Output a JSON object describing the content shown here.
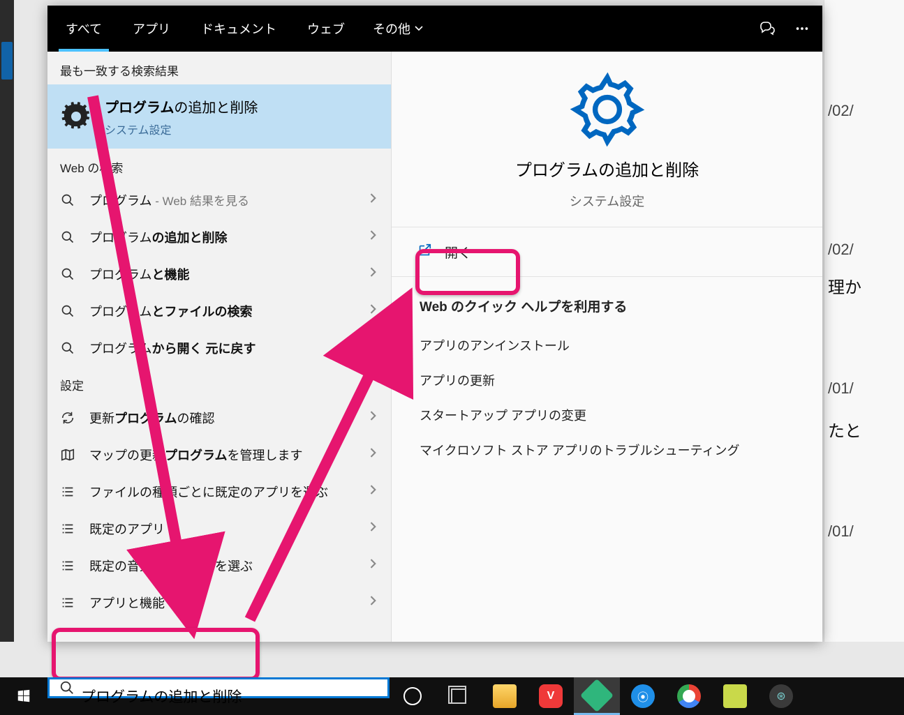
{
  "tabs": {
    "all": "すべて",
    "apps": "アプリ",
    "docs": "ドキュメント",
    "web": "ウェブ",
    "more": "その他"
  },
  "sections": {
    "best": "最も一致する検索結果",
    "web": "Web の検索",
    "settings": "設定"
  },
  "bestMatch": {
    "titlePre": "プログラム",
    "titleBold": "の追加と削除",
    "subtitle": "システム設定"
  },
  "webResults": [
    {
      "pre": "プログラム",
      "bold": "",
      "suf": " - Web 結果を見る"
    },
    {
      "pre": "プログラム",
      "bold": "の追加と削除",
      "suf": ""
    },
    {
      "pre": "プログラム",
      "bold": "と機能",
      "suf": ""
    },
    {
      "pre": "プログラム",
      "bold": "とファイルの検索",
      "suf": ""
    },
    {
      "pre": "プログラム",
      "bold": "から開く 元に戻す",
      "suf": ""
    }
  ],
  "settingsResults": [
    {
      "icon": "refresh",
      "pre": "更新",
      "bold": "プログラム",
      "post": "の確認"
    },
    {
      "icon": "map",
      "pre": "マップの更新",
      "bold": "プログラム",
      "post": "を管理します"
    },
    {
      "icon": "list",
      "pre": "ファイルの種類ごとに既定のアプリを選ぶ",
      "bold": "",
      "post": ""
    },
    {
      "icon": "list",
      "pre": "既定のアプリ",
      "bold": "",
      "post": ""
    },
    {
      "icon": "list",
      "pre": "既定の音楽プレーヤーを選ぶ",
      "bold": "",
      "post": ""
    },
    {
      "icon": "list",
      "pre": "アプリと機能",
      "bold": "",
      "post": ""
    }
  ],
  "preview": {
    "title": "プログラムの追加と削除",
    "subtitle": "システム設定",
    "open": "開く",
    "quickHelpHeader": "Web のクイック ヘルプを利用する",
    "quickLinks": [
      "アプリのアンインストール",
      "アプリの更新",
      "スタートアップ アプリの変更",
      "マイクロソフト ストア アプリのトラブルシューティング"
    ]
  },
  "searchBox": {
    "typed": "プログラム",
    "ghost": "の追加と削除"
  },
  "bgFragments": {
    "f1": "/02/",
    "f2": "/02/",
    "f3": "理か",
    "f4": "/01/",
    "f5": "たと",
    "f6": "/01/"
  }
}
